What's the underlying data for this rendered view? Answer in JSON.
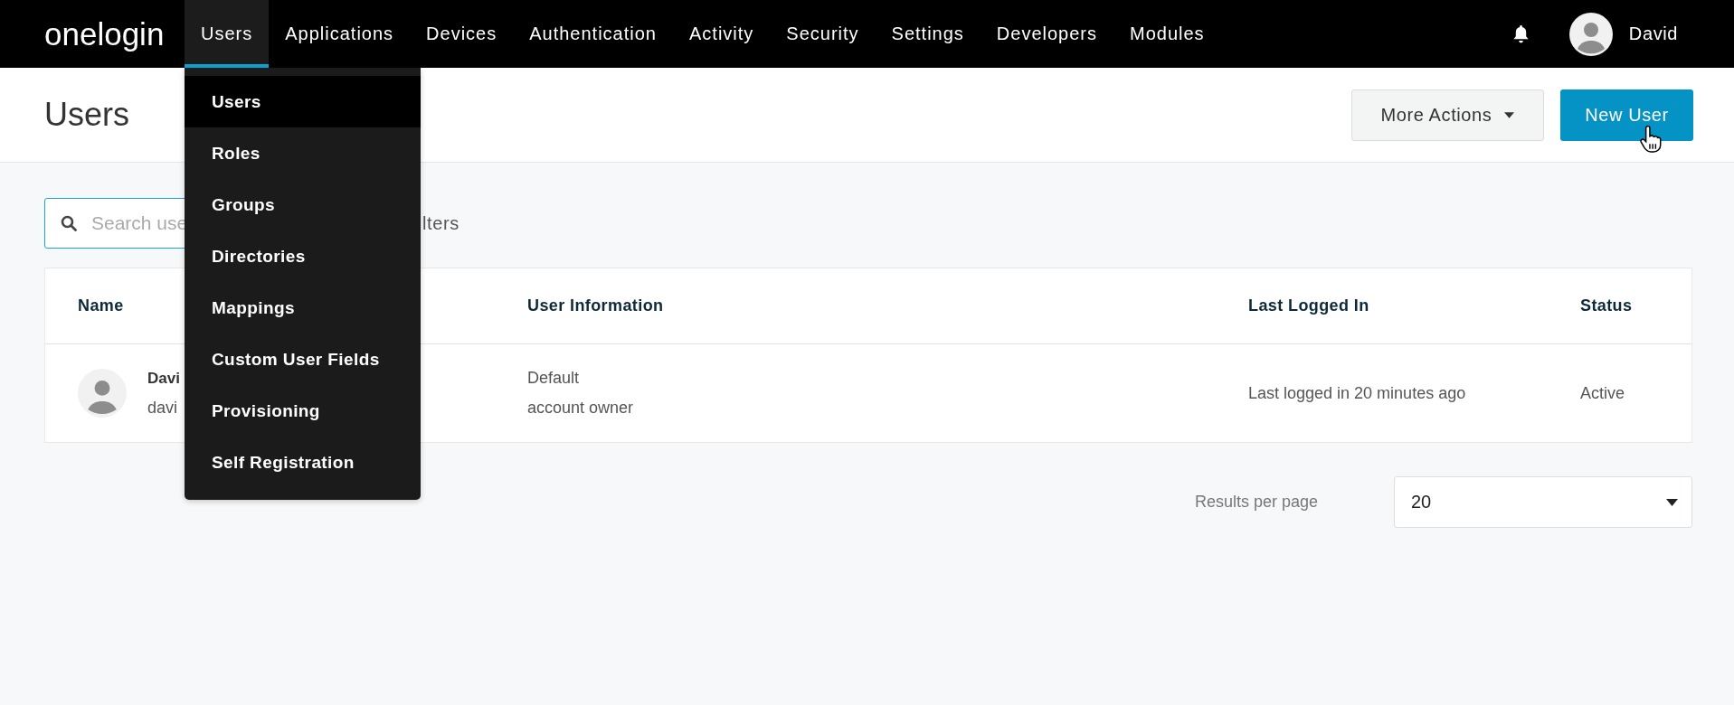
{
  "nav": {
    "logo": "onelogin",
    "items": [
      {
        "label": "Users",
        "selected": true
      },
      {
        "label": "Applications",
        "selected": false
      },
      {
        "label": "Devices",
        "selected": false
      },
      {
        "label": "Authentication",
        "selected": false
      },
      {
        "label": "Activity",
        "selected": false
      },
      {
        "label": "Security",
        "selected": false
      },
      {
        "label": "Settings",
        "selected": false
      },
      {
        "label": "Developers",
        "selected": false
      },
      {
        "label": "Modules",
        "selected": false
      }
    ],
    "user_name": "David"
  },
  "users_menu": [
    {
      "label": "Users",
      "selected": true
    },
    {
      "label": "Roles",
      "selected": false
    },
    {
      "label": "Groups",
      "selected": false
    },
    {
      "label": "Directories",
      "selected": false
    },
    {
      "label": "Mappings",
      "selected": false
    },
    {
      "label": "Custom User Fields",
      "selected": false
    },
    {
      "label": "Provisioning",
      "selected": false
    },
    {
      "label": "Self Registration",
      "selected": false
    }
  ],
  "header": {
    "title": "Users",
    "actions": [
      {
        "label": "More Actions",
        "kind": "dropdown"
      },
      {
        "label": "New User",
        "kind": "primary"
      }
    ]
  },
  "search": {
    "placeholder": "Search use"
  },
  "filters_label": "lters",
  "table": {
    "columns": [
      "Name",
      "User Information",
      "Last Logged In",
      "Status"
    ],
    "rows": [
      {
        "name": "Davi",
        "email": "davi",
        "info": [
          "Default",
          "account owner"
        ],
        "last_logged_in": "Last logged in 20 minutes ago",
        "status": "Active"
      }
    ]
  },
  "pagination": {
    "label": "Results per page",
    "value": "20"
  }
}
